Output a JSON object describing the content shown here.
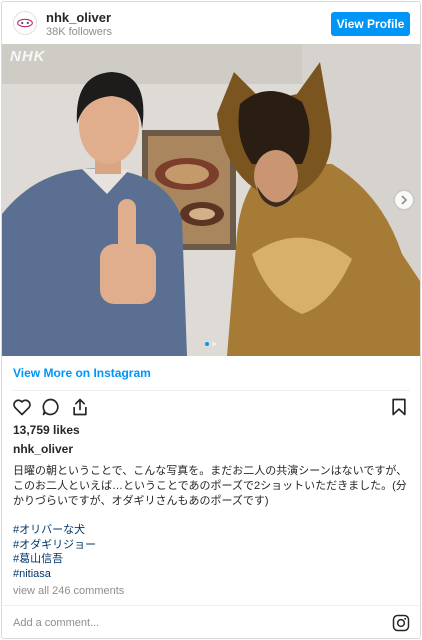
{
  "header": {
    "username": "nhk_oliver",
    "followers": "38K followers",
    "view_profile_label": "View Profile"
  },
  "photo": {
    "watermark": "NHK",
    "carousel": {
      "total": 2,
      "active": 1
    }
  },
  "view_more_label": "View More on Instagram",
  "actions": {
    "icons": [
      "heart-icon",
      "comment-icon",
      "share-icon",
      "bookmark-icon"
    ]
  },
  "likes": "13,759 likes",
  "caption": {
    "username": "nhk_oliver",
    "text": "日曜の朝ということで、こんな写真を。まだお二人の共演シーンはないですが、このお二人といえば…ということであのポーズで2ショットいただきました。(分かりづらいですが、オダギリさんもあのポーズです)",
    "hashtags": [
      "#オリバーな犬",
      "#オダギリジョー",
      "#葛山信吾",
      "#nitiasa"
    ]
  },
  "view_all_comments": "view all 246 comments",
  "comment": {
    "placeholder": "Add a comment..."
  },
  "colors": {
    "accent": "#0095f6",
    "hashtag": "#00376b",
    "muted": "#8e8e8e"
  }
}
